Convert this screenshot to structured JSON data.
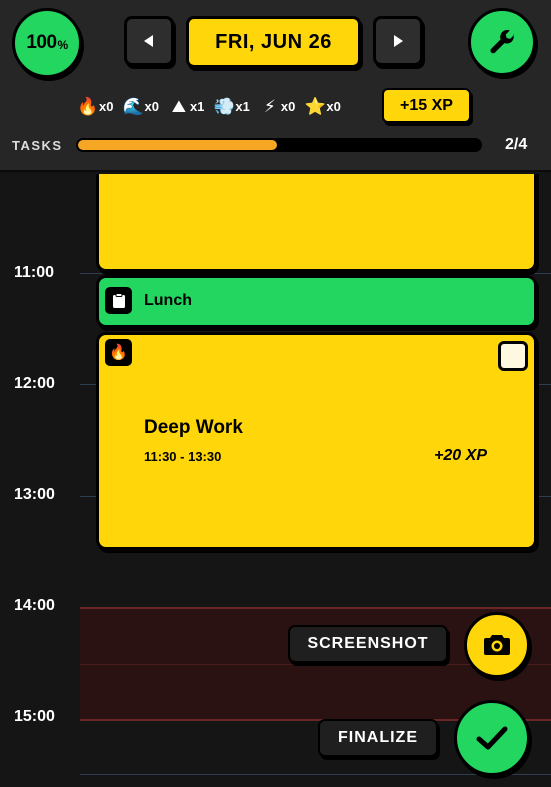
{
  "header": {
    "completion_badge": {
      "value": "100",
      "unit": "%"
    },
    "prev_day_label": "◀",
    "next_day_label": "▶",
    "date_label": "FRI, JUN 26",
    "settings_icon": "wrench-icon",
    "xp_badge": "+15 XP",
    "stats": [
      {
        "icon": "fire-icon",
        "glyph": "🔥",
        "count": "x0"
      },
      {
        "icon": "wave-icon",
        "glyph": "🌊",
        "count": "x0"
      },
      {
        "icon": "mountain-icon",
        "glyph": "⛰",
        "count": "x1"
      },
      {
        "icon": "wind-icon",
        "glyph": "💨",
        "count": "x1"
      },
      {
        "icon": "lightning-icon",
        "glyph": "⚡",
        "count": "x0"
      },
      {
        "icon": "star-icon",
        "glyph": "⭐",
        "count": "x0"
      }
    ],
    "tasks": {
      "label": "TASKS",
      "count": "2/4",
      "progress_fraction": 0.5
    }
  },
  "timeline": {
    "hours": [
      "11:00",
      "12:00",
      "13:00",
      "14:00",
      "15:00"
    ],
    "events": {
      "lunch": {
        "title": "Lunch",
        "icon": "clipboard-icon"
      },
      "deep_work": {
        "title": "Deep Work",
        "time": "11:30 - 13:30",
        "xp": "+20 XP",
        "icon": "fire-icon",
        "icon_glyph": "🔥"
      }
    }
  },
  "actions": {
    "screenshot_label": "SCREENSHOT",
    "finalize_label": "FINALIZE"
  },
  "colors": {
    "accent_yellow": "#ffd60a",
    "accent_green": "#22d660",
    "progress_orange": "#f5a623",
    "background": "#151515"
  }
}
